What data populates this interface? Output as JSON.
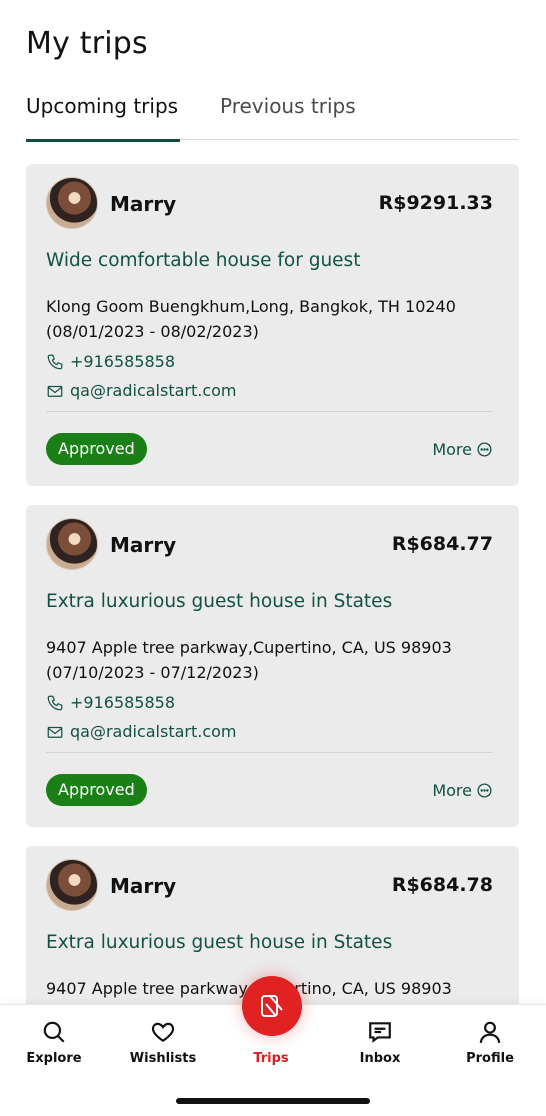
{
  "page": {
    "title": "My trips"
  },
  "tabs": [
    {
      "label": "Upcoming trips",
      "active": true
    },
    {
      "label": "Previous trips",
      "active": false
    }
  ],
  "trips": [
    {
      "host": "Marry",
      "price": "R$9291.33",
      "listing": "Wide comfortable house for guest",
      "address": "Klong Goom Buengkhum,Long, Bangkok, TH 10240",
      "dates": "(08/01/2023 - 08/02/2023)",
      "phone": "+916585858",
      "email": "qa@radicalstart.com",
      "status": "Approved",
      "more": "More"
    },
    {
      "host": "Marry",
      "price": "R$684.77",
      "listing": "Extra luxurious guest house in States",
      "address": "9407 Apple tree parkway,Cupertino, CA, US 98903",
      "dates": "(07/10/2023 - 07/12/2023)",
      "phone": "+916585858",
      "email": "qa@radicalstart.com",
      "status": "Approved",
      "more": "More"
    },
    {
      "host": "Marry",
      "price": "R$684.78",
      "listing": "Extra luxurious guest house in States",
      "address": "9407 Apple tree parkway,Cupertino, CA, US 98903"
    }
  ],
  "nav": [
    {
      "label": "Explore",
      "icon": "search-icon"
    },
    {
      "label": "Wishlists",
      "icon": "heart-icon"
    },
    {
      "label": "Trips",
      "icon": "app-logo-icon",
      "active": true
    },
    {
      "label": "Inbox",
      "icon": "message-icon"
    },
    {
      "label": "Profile",
      "icon": "user-icon"
    }
  ],
  "colors": {
    "accent_green": "#125144",
    "approved_badge": "#1a7f17",
    "brand_red": "#e02223",
    "card_background": "#ebebeb"
  }
}
